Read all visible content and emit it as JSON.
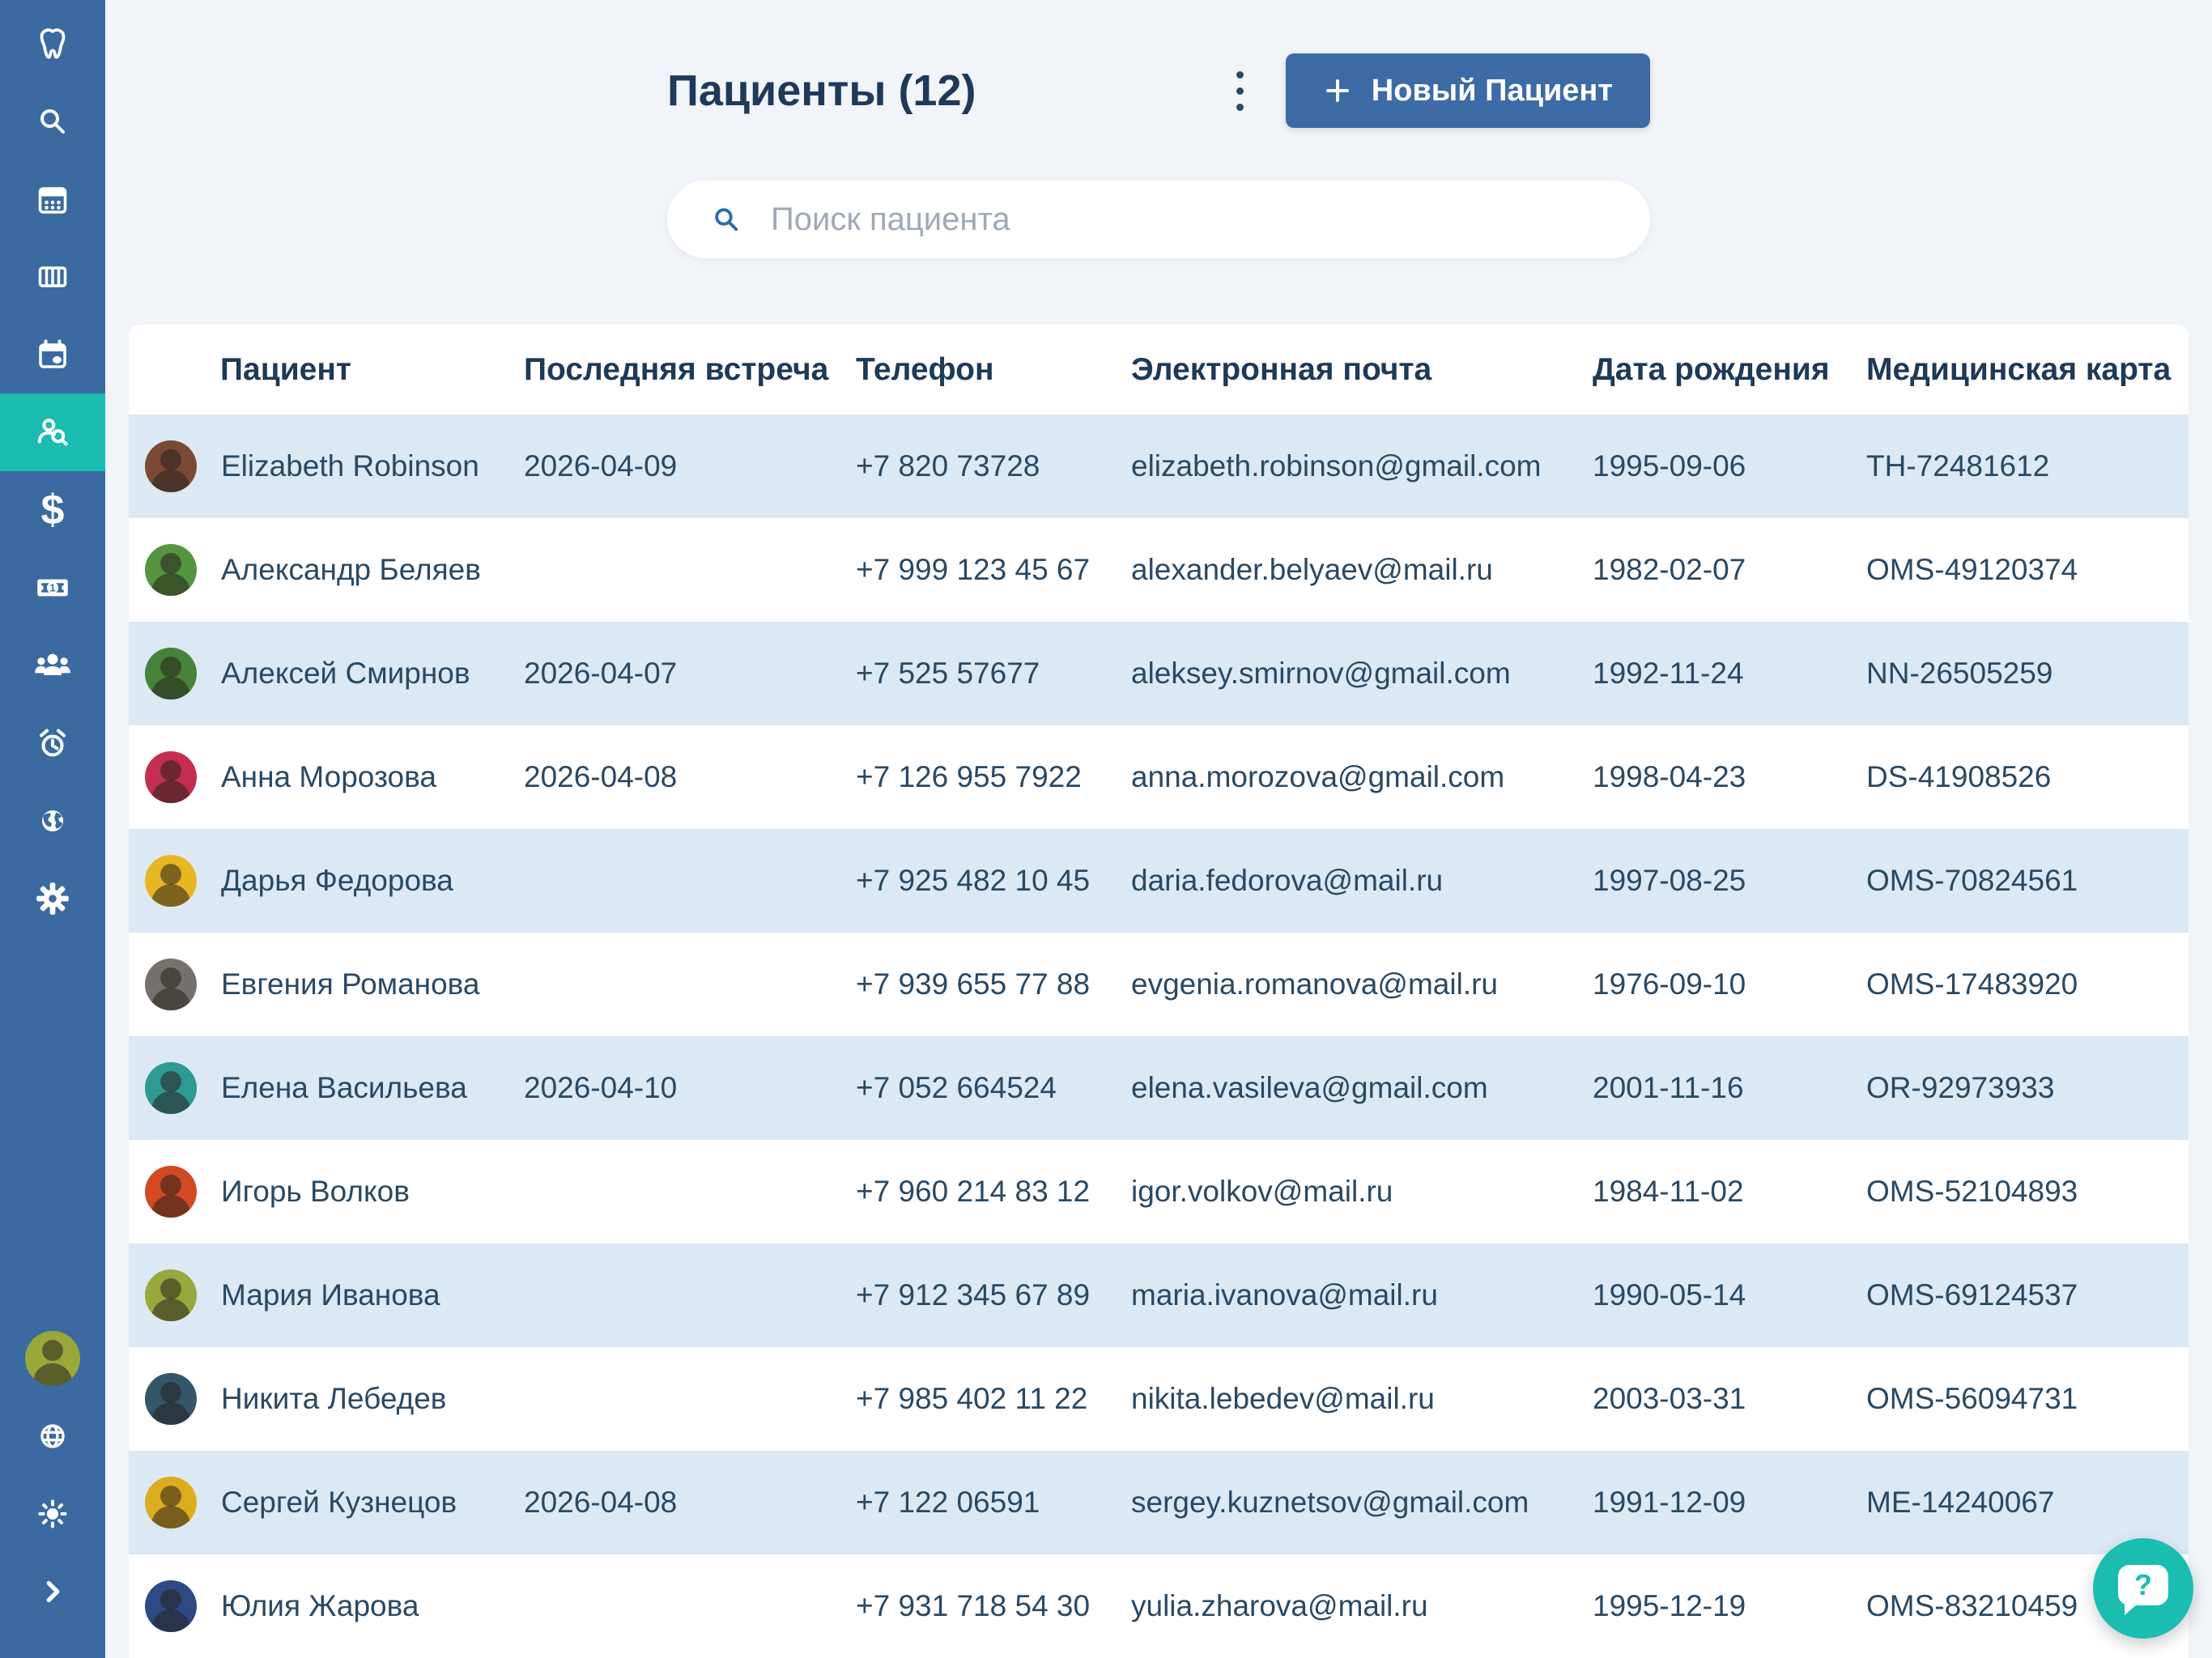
{
  "colors": {
    "sidebar": "#3b6aa1",
    "sidebar_active": "#1abdb0",
    "button_blue": "#3c6ba6",
    "row_shade": "#dce8f3",
    "text_navy": "#1d3a5c",
    "chat_teal": "#1bbdb1"
  },
  "sidebar": {
    "items": [
      {
        "icon": "tooth-logo-icon"
      },
      {
        "icon": "search-icon"
      },
      {
        "icon": "calendar-dots-icon"
      },
      {
        "icon": "kanban-columns-icon"
      },
      {
        "icon": "calendar-event-icon"
      },
      {
        "icon": "patient-search-icon",
        "active": true
      },
      {
        "icon": "dollar-icon",
        "glyph": "$"
      },
      {
        "icon": "banknote-icon"
      },
      {
        "icon": "team-icon"
      },
      {
        "icon": "alarm-clock-icon"
      },
      {
        "icon": "earth-icon"
      },
      {
        "icon": "gear-icon"
      }
    ],
    "footer": [
      {
        "icon": "user-avatar",
        "color": "#9aa83a"
      },
      {
        "icon": "globe-icon"
      },
      {
        "icon": "sun-icon"
      },
      {
        "icon": "chevron-right-icon"
      }
    ]
  },
  "header": {
    "title": "Пациенты (12)",
    "new_patient_label": "Новый Пациент"
  },
  "search": {
    "placeholder": "Поиск пациента"
  },
  "table": {
    "columns": [
      "Пациент",
      "Последняя встреча",
      "Телефон",
      "Электронная почта",
      "Дата рождения",
      "Медицинская карта"
    ],
    "rows": [
      {
        "name": "Elizabeth Robinson",
        "last_visit": "2026-04-09",
        "phone": "+7 820 73728",
        "email": "elizabeth.robinson@gmail.com",
        "birth_date": "1995-09-06",
        "med_card": "TH-72481612",
        "avatar_color": "#7b4a35"
      },
      {
        "name": "Александр Беляев",
        "last_visit": "",
        "phone": "+7 999 123 45 67",
        "email": "alexander.belyaev@mail.ru",
        "birth_date": "1982-02-07",
        "med_card": "OMS-49120374",
        "avatar_color": "#55953f"
      },
      {
        "name": "Алексей Смирнов",
        "last_visit": "2026-04-07",
        "phone": "+7 525 57677",
        "email": "aleksey.smirnov@gmail.com",
        "birth_date": "1992-11-24",
        "med_card": "NN-26505259",
        "avatar_color": "#47833a"
      },
      {
        "name": "Анна Морозова",
        "last_visit": "2026-04-08",
        "phone": "+7 126 955 7922",
        "email": "anna.morozova@gmail.com",
        "birth_date": "1998-04-23",
        "med_card": "DS-41908526",
        "avatar_color": "#c42f51"
      },
      {
        "name": "Дарья Федорова",
        "last_visit": "",
        "phone": "+7 925 482 10 45",
        "email": "daria.fedorova@mail.ru",
        "birth_date": "1997-08-25",
        "med_card": "OMS-70824561",
        "avatar_color": "#e6b722"
      },
      {
        "name": "Евгения Романова",
        "last_visit": "",
        "phone": "+7 939 655 77 88",
        "email": "evgenia.romanova@mail.ru",
        "birth_date": "1976-09-10",
        "med_card": "OMS-17483920",
        "avatar_color": "#76716c"
      },
      {
        "name": "Елена Васильева",
        "last_visit": "2026-04-10",
        "phone": "+7 052 664524",
        "email": "elena.vasileva@gmail.com",
        "birth_date": "2001-11-16",
        "med_card": "OR-92973933",
        "avatar_color": "#2f9a93"
      },
      {
        "name": "Игорь Волков",
        "last_visit": "",
        "phone": "+7 960 214 83 12",
        "email": "igor.volkov@mail.ru",
        "birth_date": "1984-11-02",
        "med_card": "OMS-52104893",
        "avatar_color": "#d14a23"
      },
      {
        "name": "Мария Иванова",
        "last_visit": "",
        "phone": "+7 912 345 67 89",
        "email": "maria.ivanova@mail.ru",
        "birth_date": "1990-05-14",
        "med_card": "OMS-69124537",
        "avatar_color": "#97a83c"
      },
      {
        "name": "Никита Лебедев",
        "last_visit": "",
        "phone": "+7 985 402 11 22",
        "email": "nikita.lebedev@mail.ru",
        "birth_date": "2003-03-31",
        "med_card": "OMS-56094731",
        "avatar_color": "#33566b"
      },
      {
        "name": "Сергей Кузнецов",
        "last_visit": "2026-04-08",
        "phone": "+7 122 06591",
        "email": "sergey.kuznetsov@gmail.com",
        "birth_date": "1991-12-09",
        "med_card": "ME-14240067",
        "avatar_color": "#dcac1e"
      },
      {
        "name": "Юлия Жарова",
        "last_visit": "",
        "phone": "+7 931 718 54 30",
        "email": "yulia.zharova@mail.ru",
        "birth_date": "1995-12-19",
        "med_card": "OMS-83210459",
        "avatar_color": "#2d4a85"
      }
    ]
  },
  "chat": {
    "glyph": "?"
  }
}
